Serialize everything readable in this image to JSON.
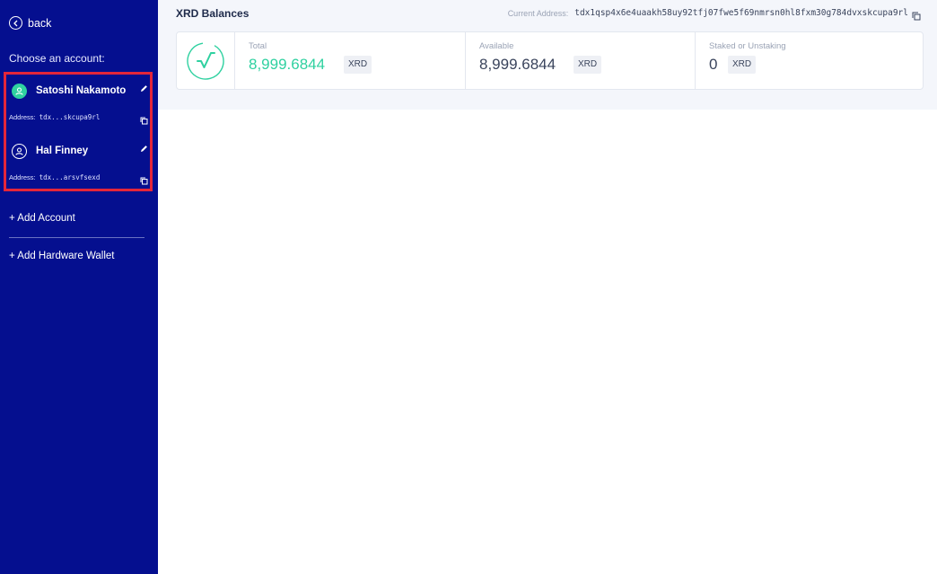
{
  "sidebar": {
    "back_label": "back",
    "choose_label": "Choose an account:",
    "accounts": [
      {
        "name": "Satoshi Nakamoto",
        "address_label": "Address:",
        "address": "tdx...skcupa9rl",
        "active": true
      },
      {
        "name": "Hal Finney",
        "address_label": "Address:",
        "address": "tdx...arsvfsexd",
        "active": false
      }
    ],
    "add_account_label": "+ Add Account",
    "add_hardware_wallet_label": "+ Add Hardware Wallet",
    "colors": {
      "background": "#050f8f",
      "highlight_border": "#e4263a",
      "active_avatar": "#2fd1a0"
    }
  },
  "main": {
    "title": "XRD Balances",
    "current_address_label": "Current Address:",
    "current_address": "tdx1qsp4x6e4uaakh58uy92tfj07fwe5f69nmrsn0hl8fxm30g784dvxskcupa9rl",
    "balances": {
      "total": {
        "label": "Total",
        "amount": "8,999.6844",
        "unit": "XRD"
      },
      "available": {
        "label": "Available",
        "amount": "8,999.6844",
        "unit": "XRD"
      },
      "staked": {
        "label": "Staked or Unstaking",
        "amount": "0",
        "unit": "XRD"
      }
    },
    "colors": {
      "accent": "#2fd1a0"
    }
  },
  "icons": {
    "back": "chevron-left-circle-icon",
    "avatar": "user-circle-icon",
    "edit": "pencil-icon",
    "copy": "copy-icon",
    "logo": "radix-logo-icon"
  }
}
